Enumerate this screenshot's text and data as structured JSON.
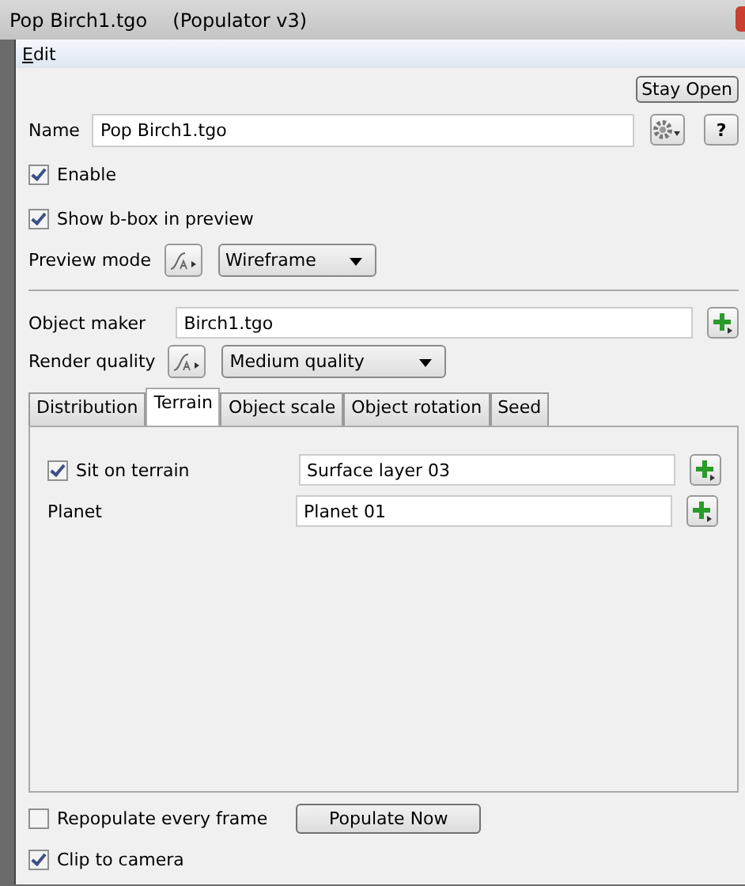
{
  "window": {
    "title": "Pop Birch1.tgo",
    "subtitle": "(Populator v3)"
  },
  "menu": [
    "Edit"
  ],
  "stay_open_button": "Stay Open",
  "help_button": "?",
  "name": {
    "label": "Name",
    "value": "Pop Birch1.tgo"
  },
  "enable": {
    "label": "Enable",
    "checked": true
  },
  "show_bbox": {
    "label": "Show b-box in preview",
    "checked": true
  },
  "preview_mode": {
    "label": "Preview mode",
    "value": "Wireframe"
  },
  "object_maker": {
    "label": "Object maker",
    "value": "Birch1.tgo"
  },
  "render_quality": {
    "label": "Render quality",
    "value": "Medium quality"
  },
  "tabs": [
    {
      "label": "Distribution",
      "selected": false
    },
    {
      "label": "Terrain",
      "selected": true
    },
    {
      "label": "Object scale",
      "selected": false
    },
    {
      "label": "Object rotation",
      "selected": false
    },
    {
      "label": "Seed",
      "selected": false
    }
  ],
  "terrain_rows": [
    {
      "kind": "checkbox",
      "label": "Sit on terrain",
      "checked": true,
      "value": "Surface layer 03"
    },
    {
      "kind": "plain",
      "label": "Planet",
      "value": "Planet 01"
    }
  ],
  "repopulate": {
    "label": "Repopulate every frame",
    "checked": false
  },
  "populate_button": "Populate Now",
  "clip": {
    "label": "Clip to camera",
    "checked": true
  }
}
